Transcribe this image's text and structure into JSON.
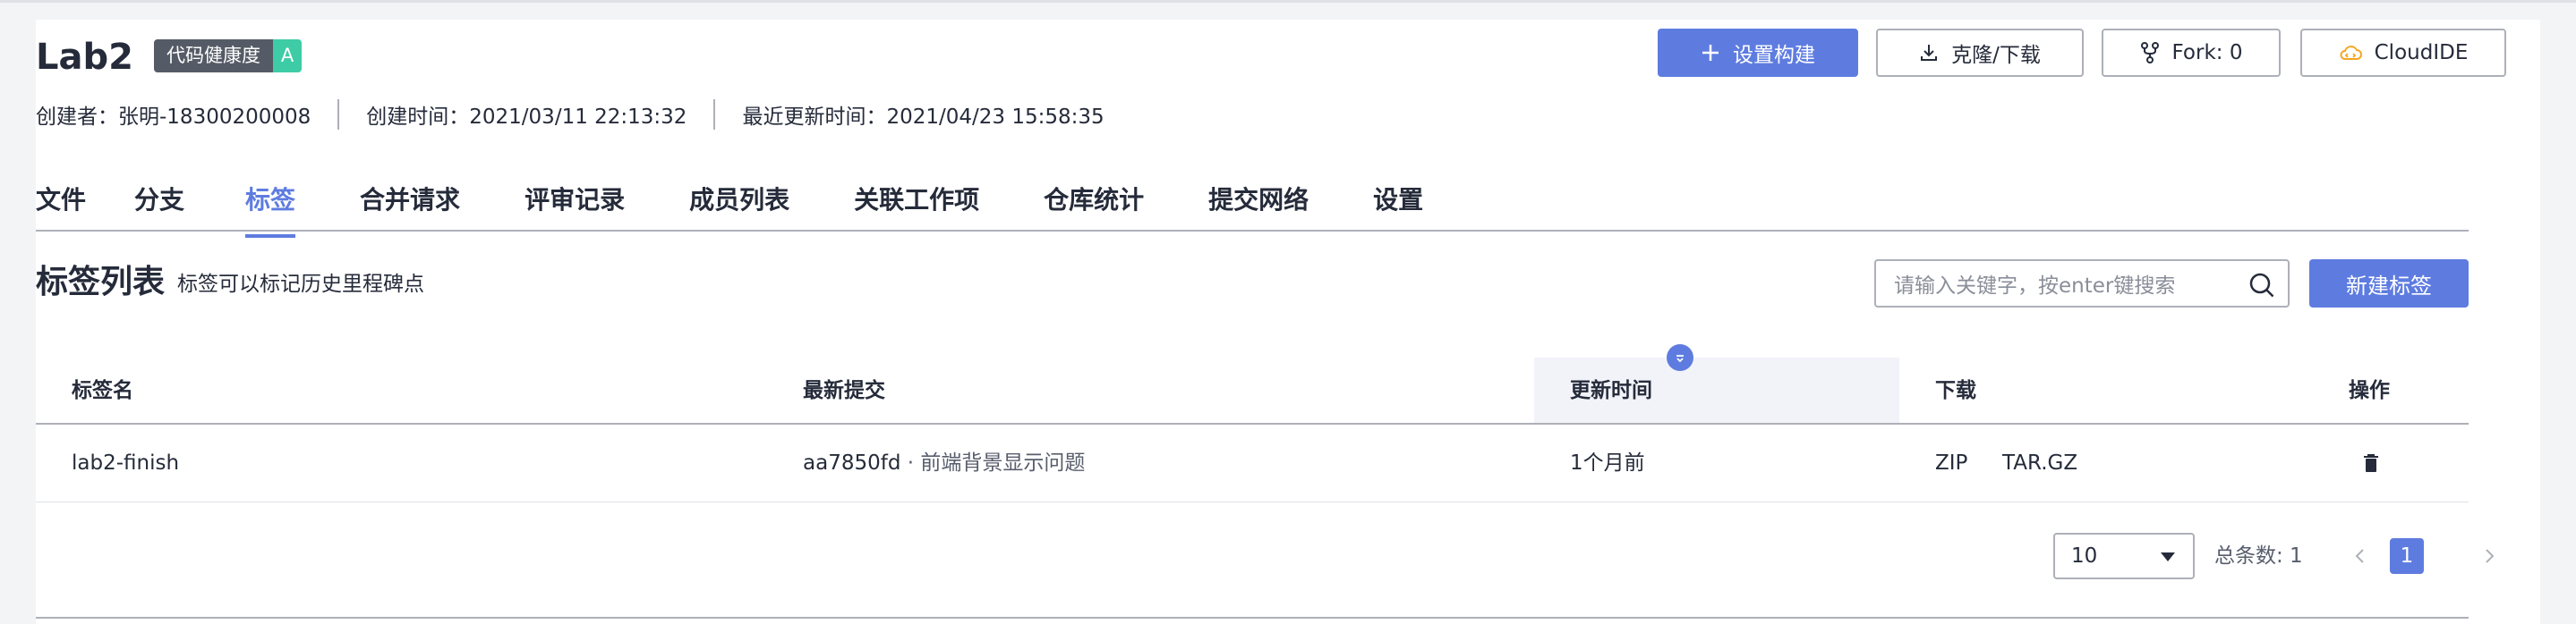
{
  "repo": {
    "name": "Lab2",
    "health_label": "代码健康度",
    "health_grade": "A",
    "meta": {
      "creator": "创建者：张明-18300200008",
      "created": "创建时间：2021/03/11 22:13:32",
      "updated": "最近更新时间：2021/04/23 15:58:35"
    }
  },
  "actions": {
    "setup_build": "设置构建",
    "clone_download": "克隆/下载",
    "fork": "Fork: 0",
    "cloudide": "CloudIDE"
  },
  "tabs": [
    {
      "label": "文件"
    },
    {
      "label": "分支"
    },
    {
      "label": "标签",
      "active": true
    },
    {
      "label": "合并请求"
    },
    {
      "label": "评审记录"
    },
    {
      "label": "成员列表"
    },
    {
      "label": "关联工作项"
    },
    {
      "label": "仓库统计"
    },
    {
      "label": "提交网络"
    },
    {
      "label": "设置"
    }
  ],
  "section": {
    "title": "标签列表",
    "description": "标签可以标记历史里程碑点",
    "search_placeholder": "请输入关键字，按enter键搜索",
    "new_tag_label": "新建标签"
  },
  "table": {
    "headers": {
      "name": "标签名",
      "latest_commit": "最新提交",
      "updated_time": "更新时间",
      "download": "下载",
      "ops": "操作"
    },
    "rows": [
      {
        "name": "lab2-finish",
        "commit_id": "aa7850fd",
        "commit_msg": " · 前端背景显示问题",
        "updated": "1个月前",
        "zip": "ZIP",
        "targz": "TAR.GZ"
      }
    ]
  },
  "pagination": {
    "page_size": "10",
    "total": "总条数: 1",
    "current_page": "1"
  },
  "colors": {
    "accent": "#5e7ce0",
    "health_badge": "#555b66",
    "grade_badge": "#3dcca6"
  },
  "icons": [
    "plus-icon",
    "download-icon",
    "fork-icon",
    "cloudide-icon",
    "search-icon",
    "sort-icon",
    "trash-icon",
    "chevron-left-icon",
    "chevron-right-icon"
  ]
}
